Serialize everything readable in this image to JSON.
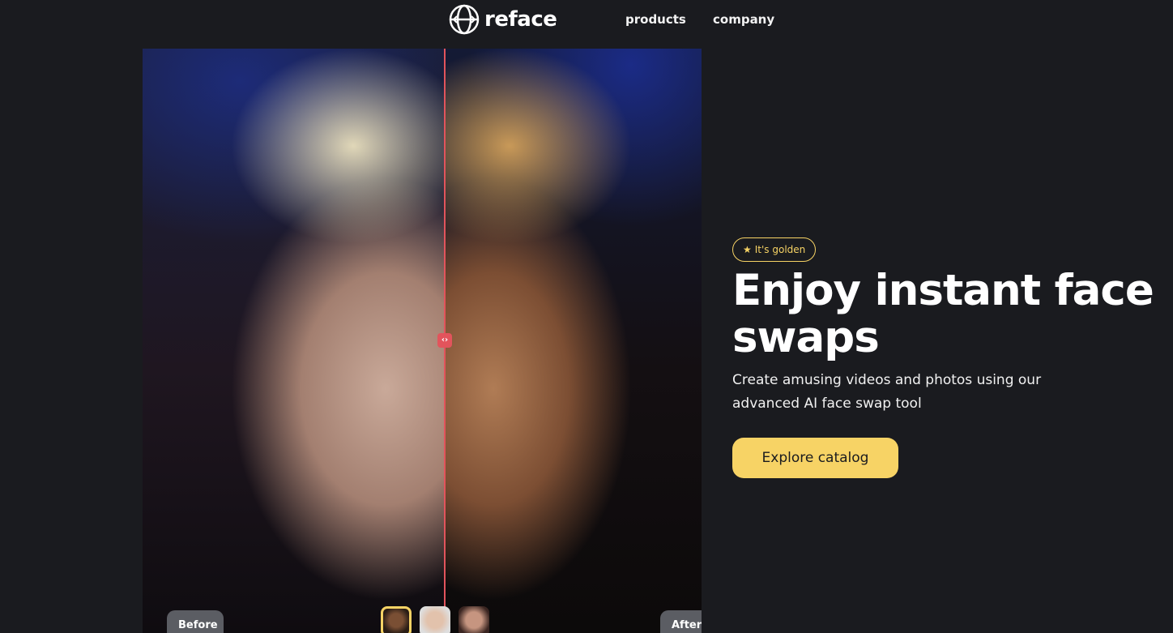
{
  "header": {
    "logo_text": "reface",
    "nav": [
      {
        "label": "products"
      },
      {
        "label": "company"
      }
    ]
  },
  "compare": {
    "before_label": "Before",
    "after_label": "After",
    "handle_glyph": "‹›",
    "thumbnails": [
      {
        "selected": true
      },
      {
        "selected": false
      },
      {
        "selected": false
      }
    ]
  },
  "hero": {
    "badge_label": "It's golden",
    "badge_icon": "star-icon",
    "title": "Enjoy instant face swaps",
    "subtitle": "Create amusing videos and photos using our advanced AI face swap tool",
    "cta_label": "Explore catalog"
  },
  "colors": {
    "background": "#1a1b1f",
    "accent": "#f7d365",
    "divider": "#e2545c"
  }
}
